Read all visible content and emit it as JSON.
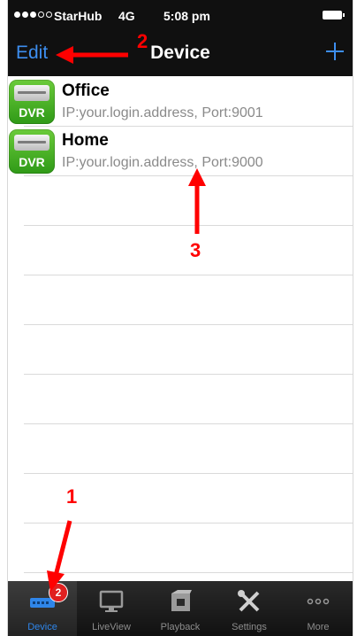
{
  "status_bar": {
    "carrier": "StarHub",
    "network": "4G",
    "time": "5:08 pm"
  },
  "nav": {
    "edit_label": "Edit",
    "title": "Device",
    "add_icon": "plus-icon"
  },
  "devices": [
    {
      "name": "Office",
      "detail": "IP:your.login.address, Port:9001",
      "icon_text": "DVR"
    },
    {
      "name": "Home",
      "detail": "IP:your.login.address, Port:9000",
      "icon_text": "DVR"
    }
  ],
  "annotations": [
    {
      "label": "1",
      "color": "#ff0000"
    },
    {
      "label": "2",
      "color": "#ff0000"
    },
    {
      "label": "3",
      "color": "#ff0000"
    }
  ],
  "tabs": [
    {
      "label": "Device",
      "icon": "dvr-device-icon",
      "active": true,
      "badge": "2"
    },
    {
      "label": "LiveView",
      "icon": "monitor-icon",
      "active": false
    },
    {
      "label": "Playback",
      "icon": "playback-icon",
      "active": false
    },
    {
      "label": "Settings",
      "icon": "tools-icon",
      "active": false
    },
    {
      "label": "More",
      "icon": "more-dots-icon",
      "active": false
    }
  ],
  "colors": {
    "accent": "#2f86ea",
    "nav_bg": "#101010",
    "annotation": "#ff0000",
    "dvr_green": "#3fae22"
  }
}
